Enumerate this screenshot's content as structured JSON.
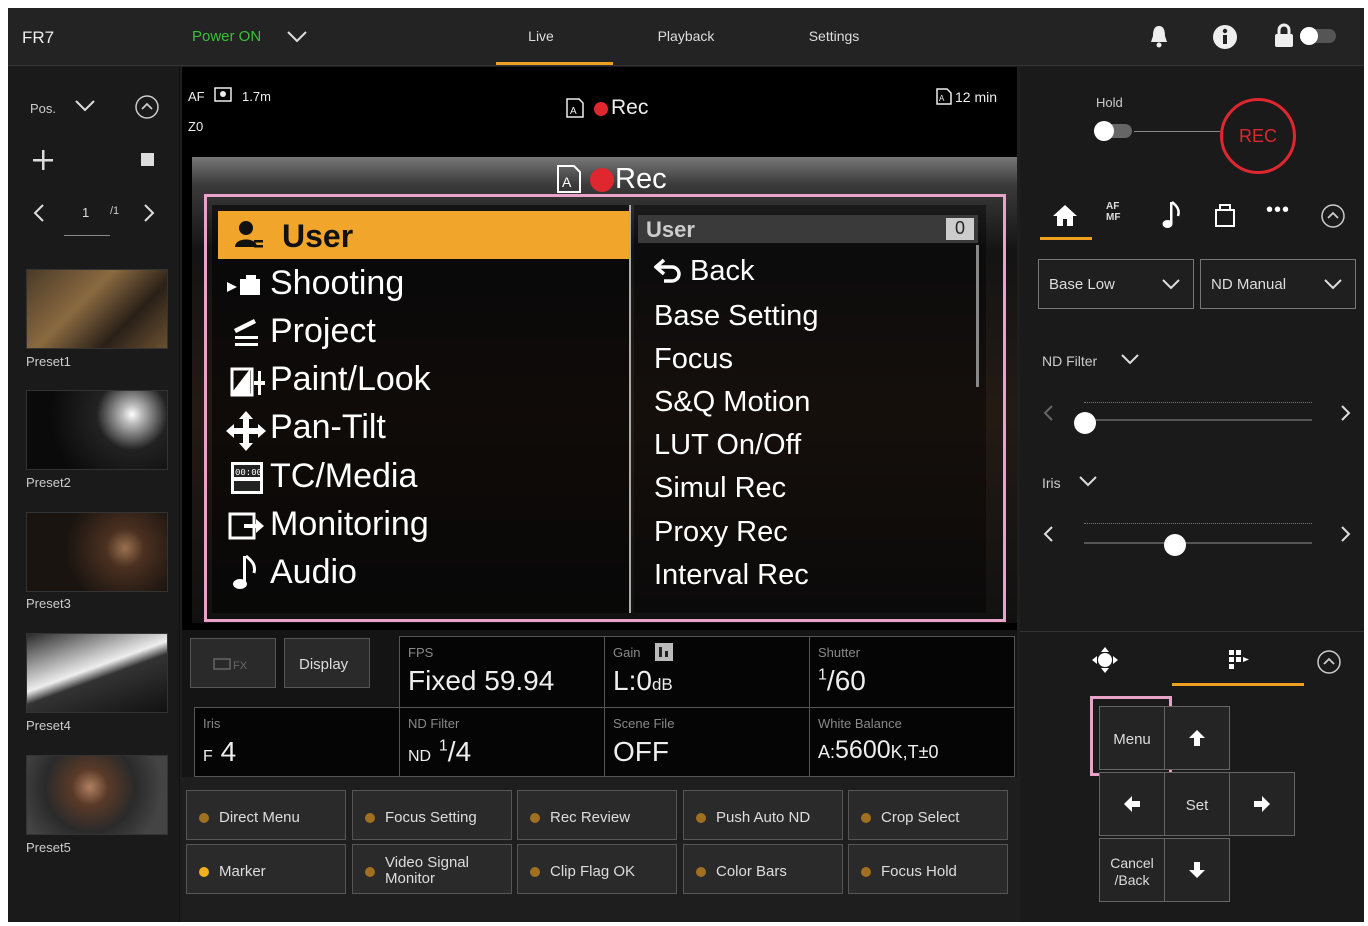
{
  "topbar": {
    "title": "FR7",
    "power": "Power ON",
    "tabs": [
      "Live",
      "Playback",
      "Settings"
    ]
  },
  "left": {
    "pos_label": "Pos.",
    "page": "1",
    "page_total": "/1",
    "presets": [
      "Preset1",
      "Preset2",
      "Preset3",
      "Preset4",
      "Preset5"
    ]
  },
  "view": {
    "af": "AF",
    "distance": "1.7m",
    "zoom": "Z0",
    "rec_label": "Rec",
    "remaining": "12 min"
  },
  "menu": {
    "header_rec": "Rec",
    "left_items": [
      "User",
      "Shooting",
      "Project",
      "Paint/Look",
      "Pan-Tilt",
      "TC/Media",
      "Monitoring",
      "Audio"
    ],
    "right_title": "User",
    "right_count": "0",
    "right_items": [
      "Back",
      "Base Setting",
      "Focus",
      "S&Q Motion",
      "LUT On/Off",
      "Simul Rec",
      "Proxy Rec",
      "Interval Rec"
    ]
  },
  "status": {
    "display_btn": "Display",
    "fps_label": "FPS",
    "fps_value": "Fixed 59.94",
    "gain_label": "Gain",
    "gain_value": "L:0",
    "gain_unit": "dB",
    "shutter_label": "Shutter",
    "shutter_num": "1",
    "shutter_den": "60",
    "iris_label": "Iris",
    "iris_f": "F",
    "iris_value": "4",
    "nd_label": "ND Filter",
    "nd_prefix": "ND",
    "nd_num": "1",
    "nd_den": "4",
    "scene_label": "Scene File",
    "scene_value": "OFF",
    "wb_label": "White Balance",
    "wb_a": "A:",
    "wb_value": "5600",
    "wb_k": "K,T±0"
  },
  "assign": [
    "Direct Menu",
    "Focus Setting",
    "Rec Review",
    "Push Auto ND",
    "Crop Select",
    "Marker",
    "Video Signal Monitor",
    "Clip Flag OK",
    "Color Bars",
    "Focus Hold"
  ],
  "right": {
    "hold": "Hold",
    "rec": "REC",
    "base": "Base Low",
    "nd_mode": "ND Manual",
    "nd_filter": "ND Filter",
    "iris": "Iris",
    "menu": "Menu",
    "set": "Set",
    "cancel": "Cancel /Back",
    "rec_color": "#e0262e",
    "accent": "#f0a020",
    "af_mf": "AF MF"
  }
}
